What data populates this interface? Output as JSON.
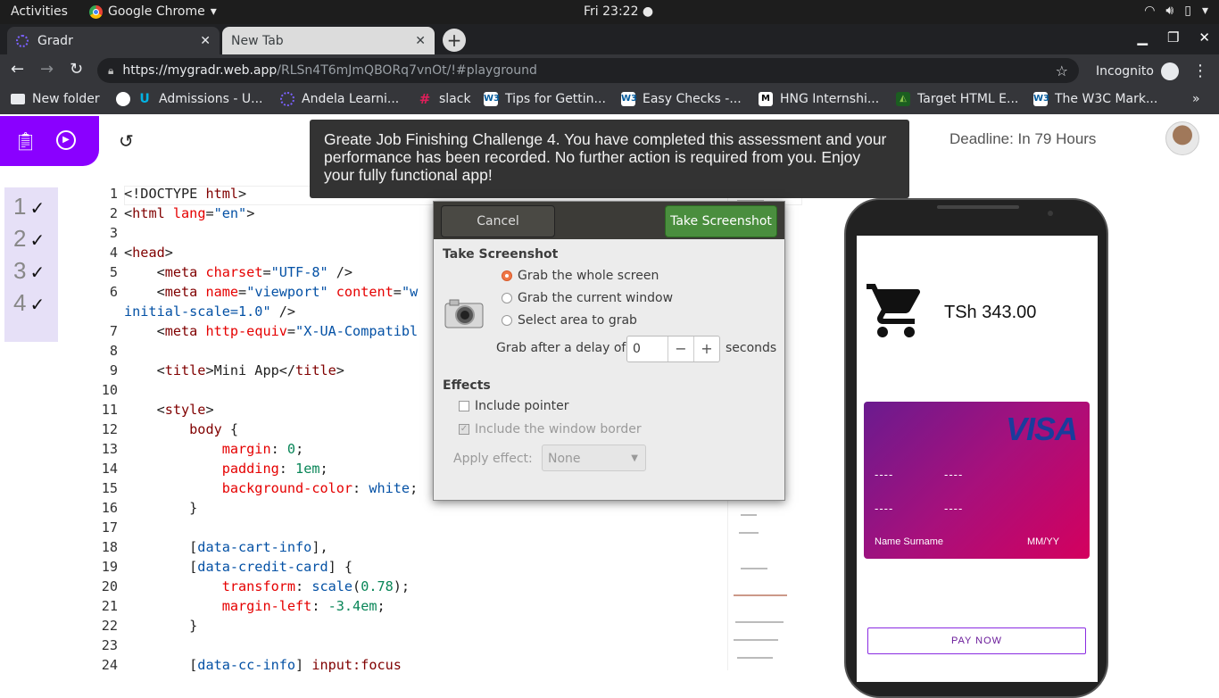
{
  "topbar": {
    "activities": "Activities",
    "app_name": "Google Chrome",
    "clock": "Fri 23:22 ●"
  },
  "tabs": [
    {
      "title": "Gradr"
    },
    {
      "title": "New Tab"
    }
  ],
  "address": {
    "host": "https://mygradr.web.app",
    "path": "/RLSn4T6mJmQBORq7vnOt/!#playground",
    "profile": "Incognito"
  },
  "bookmarks": [
    {
      "label": "New folder",
      "icon": "folder-icon"
    },
    {
      "label": "Admissions - U...",
      "icon": "udacity-icon"
    },
    {
      "label": "Andela Learni...",
      "icon": "andela-icon"
    },
    {
      "label": "slack",
      "icon": "slack-icon"
    },
    {
      "label": "Tips for Gettin...",
      "icon": "w3c-icon"
    },
    {
      "label": "Easy Checks -...",
      "icon": "w3c-icon"
    },
    {
      "label": "HNG Internshi...",
      "icon": "medium-icon"
    },
    {
      "label": "Target HTML E...",
      "icon": "android-icon"
    },
    {
      "label": "The W3C Mark...",
      "icon": "w3c-icon"
    }
  ],
  "page": {
    "deadline": "Deadline: In 79 Hours",
    "tasks": [
      "1",
      "2",
      "3",
      "4"
    ],
    "toast": "Greate Job Finishing Challenge 4. You have completed this assessment and your performance has been recorded. No further action is required from you. Enjoy your fully functional app!"
  },
  "editor": {
    "line_numbers": [
      "1",
      "2",
      "3",
      "4",
      "5",
      "6",
      "7",
      "8",
      "9",
      "10",
      "11",
      "12",
      "13",
      "14",
      "15",
      "16",
      "17",
      "18",
      "19",
      "20",
      "21",
      "22",
      "23",
      "24"
    ]
  },
  "dialog": {
    "cancel": "Cancel",
    "take": "Take Screenshot",
    "section_title": "Take Screenshot",
    "opt_whole": "Grab the whole screen",
    "opt_window": "Grab the current window",
    "opt_area": "Select area to grab",
    "delay_label": "Grab after a delay of",
    "delay_value": "0",
    "delay_unit": "seconds",
    "effects_title": "Effects",
    "include_pointer": "Include pointer",
    "include_border": "Include the window border",
    "apply_effect": "Apply effect:",
    "effect_value": "None"
  },
  "phone": {
    "total": "TSh 343.00",
    "card_brand": "VISA",
    "card_row1_a": "----",
    "card_row1_b": "----",
    "card_row2_a": "----",
    "card_row2_b": "----",
    "card_name": "Name Surname",
    "card_expiry": "MM/YY",
    "pay_button": "PAY NOW"
  }
}
